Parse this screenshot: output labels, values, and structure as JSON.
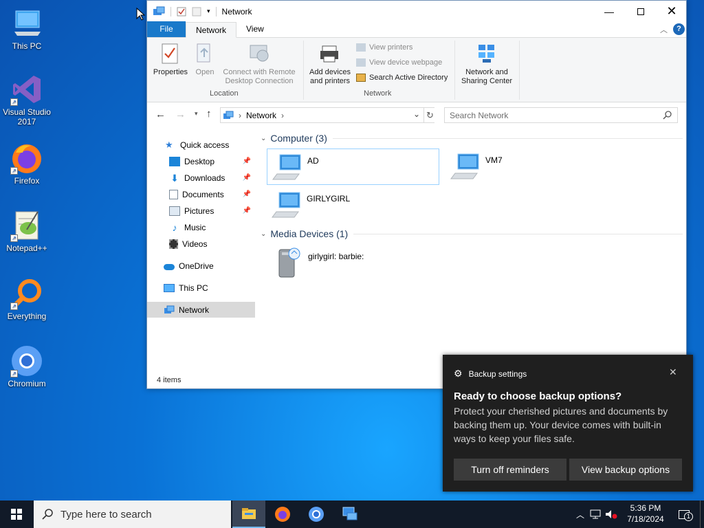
{
  "desktop": {
    "icons": [
      {
        "label": "This PC"
      },
      {
        "label": "Visual Studio 2017"
      },
      {
        "label": "Firefox"
      },
      {
        "label": "Notepad++"
      },
      {
        "label": "Everything"
      },
      {
        "label": "Chromium"
      }
    ]
  },
  "window": {
    "title": "Network",
    "tabs": {
      "file": "File",
      "network": "Network",
      "view": "View"
    },
    "ribbon": {
      "properties": "Properties",
      "open": "Open",
      "connect_line1": "Connect with Remote",
      "connect_line2": "Desktop Connection",
      "location_group": "Location",
      "add_devices_line1": "Add devices",
      "add_devices_line2": "and printers",
      "view_printers": "View printers",
      "view_device_webpage": "View device webpage",
      "search_ad": "Search Active Directory",
      "network_group": "Network",
      "nsc_line1": "Network and",
      "nsc_line2": "Sharing Center"
    },
    "address": {
      "crumb": "Network",
      "search_placeholder": "Search Network"
    },
    "nav": {
      "quick_access": "Quick access",
      "desktop": "Desktop",
      "downloads": "Downloads",
      "documents": "Documents",
      "pictures": "Pictures",
      "music": "Music",
      "videos": "Videos",
      "onedrive": "OneDrive",
      "this_pc": "This PC",
      "network": "Network"
    },
    "groups": {
      "computer": "Computer (3)",
      "media": "Media Devices (1)"
    },
    "items": {
      "ad": "AD",
      "vm7": "VM7",
      "girlygirl": "GIRLYGIRL",
      "media_device": "girlygirl: barbie:"
    },
    "status": "4 items"
  },
  "toast": {
    "app": "Backup settings",
    "title": "Ready to choose backup options?",
    "body": "Protect your cherished pictures and documents by backing them up. Your device comes with built-in ways to keep your files safe.",
    "btn_off": "Turn off reminders",
    "btn_view": "View backup options"
  },
  "taskbar": {
    "search_placeholder": "Type here to search",
    "time": "5:36 PM",
    "date": "7/18/2024",
    "notifications": "1"
  }
}
